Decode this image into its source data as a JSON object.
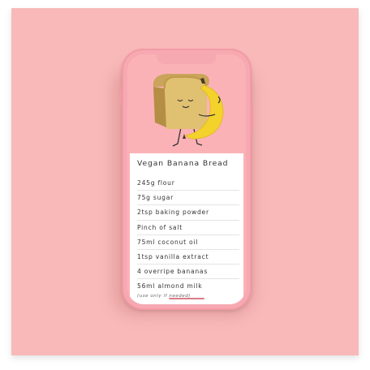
{
  "recipe": {
    "title": "Vegan Banana Bread",
    "ingredients": [
      "245g flour",
      "75g sugar",
      "2tsp baking powder",
      "Pinch of salt",
      "75ml coconut oil",
      "1tsp vanilla extract",
      "4 overripe bananas",
      "56ml almond milk"
    ],
    "note": "(use only if needed)"
  },
  "colors": {
    "background": "#f9b9b9",
    "phone": "#f7a9b2",
    "bread": "#d8b66a",
    "banana": "#f3d22c"
  },
  "illustration": {
    "icon": "bread-hugging-banana-icon"
  }
}
